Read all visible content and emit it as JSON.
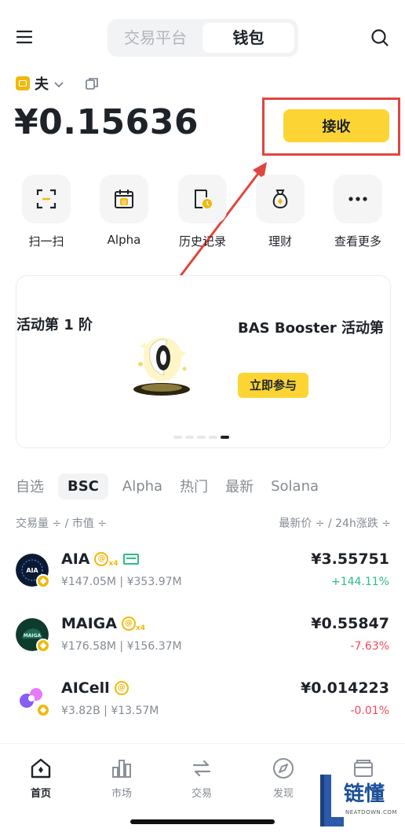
{
  "header": {
    "tabs": [
      "交易平台",
      "钱包"
    ],
    "active_tab": "钱包"
  },
  "account": {
    "name": "夫",
    "balance": "¥0.15636",
    "receive_label": "接收"
  },
  "quick_actions": [
    {
      "label": "扫一扫",
      "icon": "scan-icon"
    },
    {
      "label": "Alpha",
      "icon": "alpha-calendar-icon"
    },
    {
      "label": "历史记录",
      "icon": "history-icon"
    },
    {
      "label": "理财",
      "icon": "earn-bag-icon"
    },
    {
      "label": "查看更多",
      "icon": "more-icon"
    }
  ],
  "banner": {
    "left_text": "活动第 1 阶",
    "right_text": "BAS Booster 活动第",
    "cta": "立即参与",
    "dots": 5,
    "active_dot": 4
  },
  "market_tabs": [
    "自选",
    "BSC",
    "Alpha",
    "热门",
    "最新",
    "Solana"
  ],
  "active_market_tab": "BSC",
  "sort": {
    "left": "交易量 ÷ / 市值 ÷",
    "right": "最新价 ÷ / 24h涨跌 ÷"
  },
  "tokens": [
    {
      "symbol": "AIA",
      "volume": "¥147.05M",
      "mcap": "¥353.97M",
      "price": "¥3.55751",
      "change": "+144.11%",
      "direction": "up",
      "tags": [
        "alpha-x4",
        "green-box"
      ]
    },
    {
      "symbol": "MAIGA",
      "volume": "¥176.58M",
      "mcap": "¥156.37M",
      "price": "¥0.55847",
      "change": "-7.63%",
      "direction": "down",
      "tags": [
        "alpha-x4"
      ]
    },
    {
      "symbol": "AICell",
      "volume": "¥3.82B",
      "mcap": "¥13.57M",
      "price": "¥0.014223",
      "change": "-0.01%",
      "direction": "down",
      "tags": [
        "alpha"
      ]
    }
  ],
  "bottom_nav": [
    {
      "label": "首页",
      "icon": "home-icon",
      "active": true
    },
    {
      "label": "市场",
      "icon": "market-icon",
      "active": false
    },
    {
      "label": "交易",
      "icon": "trade-icon",
      "active": false
    },
    {
      "label": "发现",
      "icon": "discover-icon",
      "active": false
    },
    {
      "label": "",
      "icon": "wallet-icon",
      "active": false
    }
  ],
  "watermark": {
    "text": "链懂",
    "sub": "NEATDOWN.COM"
  },
  "colors": {
    "accent": "#fcd535",
    "up": "#2ebd85",
    "down": "#f6465d",
    "annotation": "#e0463f"
  }
}
